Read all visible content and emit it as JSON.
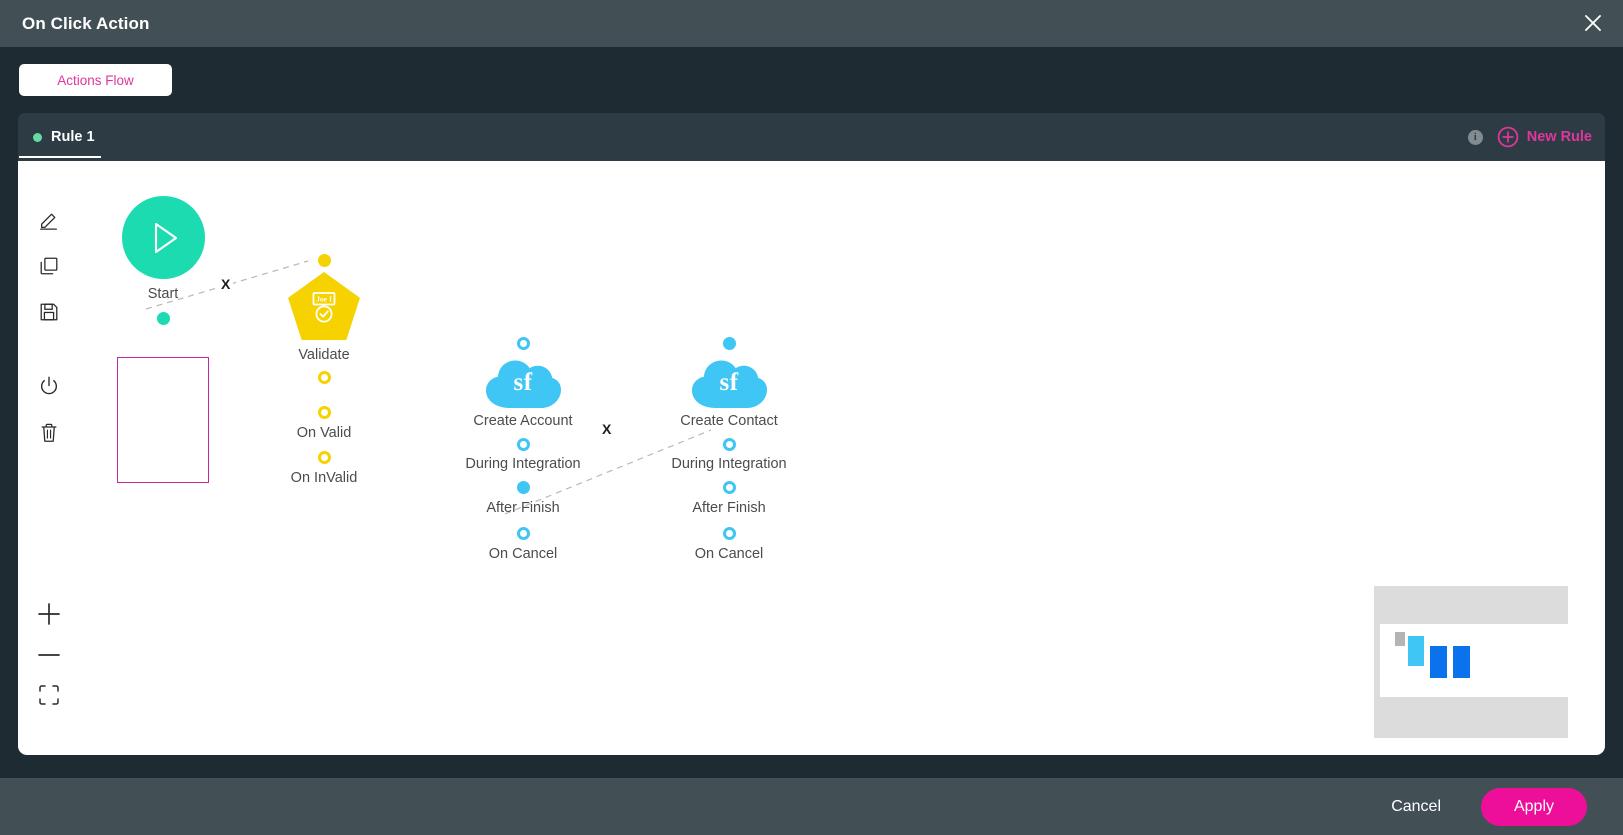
{
  "window": {
    "title": "On Click Action",
    "close_icon": "close-icon"
  },
  "toolbar": {
    "actions_flow_label": "Actions Flow"
  },
  "rule_tabs": {
    "tabs": [
      {
        "label": "Rule 1",
        "active": true,
        "status_color": "#68d9a0"
      }
    ],
    "info_icon_label": "i",
    "new_rule_label": "New Rule",
    "new_rule_icon": "plus-circle-icon"
  },
  "tools": [
    {
      "name": "edit-tool",
      "icon": "pencil-icon"
    },
    {
      "name": "copy-tool",
      "icon": "copy-icon"
    },
    {
      "name": "save-tool",
      "icon": "floppy-disk-icon"
    },
    {
      "name": "power-tool",
      "icon": "power-icon"
    },
    {
      "name": "delete-tool",
      "icon": "trash-icon"
    },
    {
      "name": "zoom-in-tool",
      "icon": "plus-icon"
    },
    {
      "name": "zoom-out-tool",
      "icon": "minus-icon"
    },
    {
      "name": "fit-screen-tool",
      "icon": "fit-screen-icon"
    }
  ],
  "flow": {
    "nodes": [
      {
        "id": "start",
        "label": "Start",
        "type": "start",
        "selected": true,
        "icon": "play-icon",
        "color": "#1ddbb0",
        "ports": [
          {
            "label": "",
            "style": "dot-teal"
          }
        ]
      },
      {
        "id": "validate",
        "label": "Validate",
        "type": "validate",
        "selected": false,
        "icon": "id-badge-check-icon",
        "color": "#f5d200",
        "badge_text": "Joe I",
        "input_port": "dot-yellow",
        "ports": [
          {
            "label": "",
            "style": "ring-yellow"
          },
          {
            "label": "On Valid",
            "style": "ring-yellow"
          },
          {
            "label": "On InValid",
            "style": "ring-yellow"
          }
        ]
      },
      {
        "id": "create-account",
        "label": "Create Account",
        "type": "salesforce",
        "selected": false,
        "icon": "salesforce-cloud-icon",
        "cloud_text": "sf",
        "color": "#3fc6f4",
        "input_port": "ring-blue",
        "ports": [
          {
            "label": "During Integration",
            "style": "ring-blue"
          },
          {
            "label": "After Finish",
            "style": "dot-blue"
          },
          {
            "label": "On Cancel",
            "style": "ring-blue"
          }
        ]
      },
      {
        "id": "create-contact",
        "label": "Create Contact",
        "type": "salesforce",
        "selected": false,
        "icon": "salesforce-cloud-icon",
        "cloud_text": "sf",
        "color": "#3fc6f4",
        "input_port": "dot-blue",
        "ports": [
          {
            "label": "During Integration",
            "style": "ring-blue"
          },
          {
            "label": "After Finish",
            "style": "ring-blue"
          },
          {
            "label": "On Cancel",
            "style": "ring-blue"
          }
        ]
      }
    ],
    "edges": [
      {
        "from": "start",
        "to": "validate",
        "delete_label": "X"
      },
      {
        "from": "create-account",
        "to": "create-contact",
        "delete_label": "X"
      }
    ]
  },
  "minimap": {
    "nodes": [
      {
        "color": "#b4b4b4"
      },
      {
        "color": "#3fc6f4"
      },
      {
        "color": "#0b72ee"
      },
      {
        "color": "#0b72ee"
      }
    ]
  },
  "footer": {
    "cancel_label": "Cancel",
    "apply_label": "Apply",
    "apply_color": "#ed0f9a"
  }
}
